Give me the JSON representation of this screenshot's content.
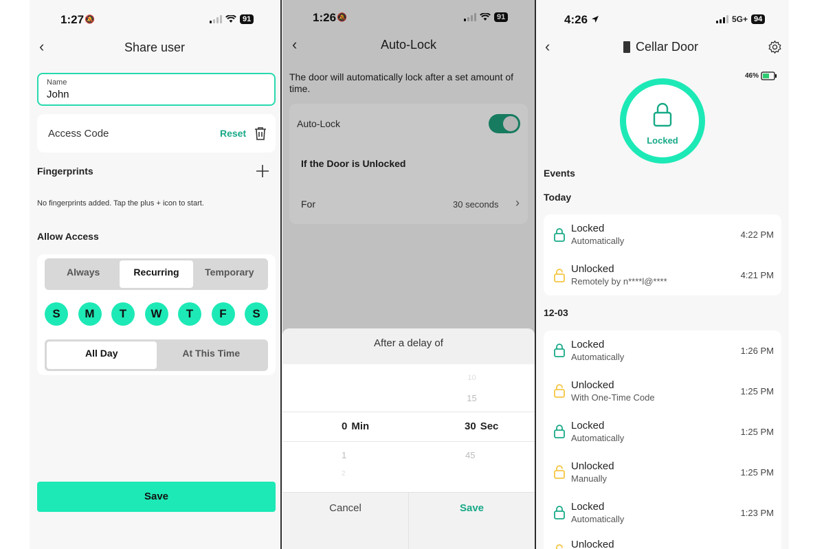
{
  "panel1": {
    "status": {
      "time": "1:27",
      "battery": "91"
    },
    "title": "Share user",
    "name_field": {
      "label": "Name",
      "value": "John"
    },
    "access_code": {
      "label": "Access Code",
      "reset": "Reset"
    },
    "fingerprints": {
      "heading": "Fingerprints",
      "empty_text": "No fingerprints added. Tap the plus + icon to start."
    },
    "allow_access": {
      "heading": "Allow Access",
      "modes": [
        "Always",
        "Recurring",
        "Temporary"
      ],
      "selected_mode": "Recurring",
      "days": [
        "S",
        "M",
        "T",
        "W",
        "T",
        "F",
        "S"
      ],
      "time_options": [
        "All Day",
        "At This Time"
      ],
      "selected_time": "All Day"
    },
    "save": "Save"
  },
  "panel2": {
    "status": {
      "time": "1:26",
      "battery": "91"
    },
    "title": "Auto-Lock",
    "description": "The door will automatically lock after a set amount of time.",
    "auto_lock_label": "Auto-Lock",
    "auto_lock_on": true,
    "unlocked_heading": "If the Door is Unlocked",
    "for_label": "For",
    "for_value": "30 seconds",
    "sheet": {
      "title": "After a delay of",
      "minutes": {
        "above": "",
        "selected": "0",
        "unit": "Min",
        "below": "1",
        "below2": "2"
      },
      "seconds": {
        "above2": "10",
        "above": "15",
        "selected": "30",
        "unit": "Sec",
        "below": "45"
      },
      "cancel": "Cancel",
      "save": "Save"
    }
  },
  "panel3": {
    "status": {
      "time": "4:26",
      "network": "5G+",
      "battery": "94"
    },
    "title": "Cellar Door",
    "lock_battery": "46%",
    "lock_state": "Locked",
    "events_heading": "Events",
    "groups": [
      {
        "label": "Today",
        "events": [
          {
            "title": "Locked",
            "detail": "Automatically",
            "time": "4:22 PM",
            "locked": true
          },
          {
            "title": "Unlocked",
            "detail": "Remotely by n****l@****",
            "time": "4:21 PM",
            "locked": false
          }
        ]
      },
      {
        "label": "12-03",
        "events": [
          {
            "title": "Locked",
            "detail": "Automatically",
            "time": "1:26 PM",
            "locked": true
          },
          {
            "title": "Unlocked",
            "detail": "With One-Time Code",
            "time": "1:25 PM",
            "locked": false
          },
          {
            "title": "Locked",
            "detail": "Automatically",
            "time": "1:25 PM",
            "locked": true
          },
          {
            "title": "Unlocked",
            "detail": "Manually",
            "time": "1:25 PM",
            "locked": false
          },
          {
            "title": "Locked",
            "detail": "Automatically",
            "time": "1:23 PM",
            "locked": true
          },
          {
            "title": "Unlocked",
            "detail": "",
            "time": "",
            "locked": false
          }
        ]
      }
    ],
    "colors": {
      "accent": "#1de9b6",
      "locked_icon": "#17a987",
      "unlocked_icon": "#f5c542"
    }
  }
}
